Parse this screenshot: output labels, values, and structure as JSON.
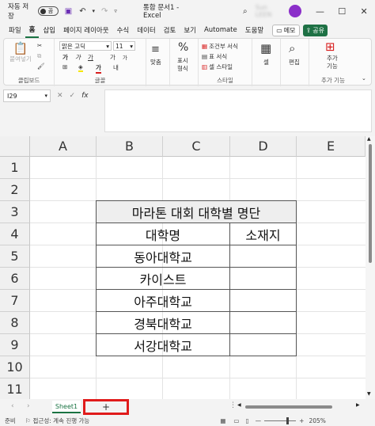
{
  "titlebar": {
    "autosave_label": "자동 저장",
    "autosave_state": "끔",
    "doc_title": "통합 문서1  -  Excel",
    "user_name": "Sun LEEN",
    "minimize": "—",
    "maximize": "☐",
    "close": "✕"
  },
  "menu": {
    "items": [
      "파일",
      "홈",
      "삽입",
      "페이지 레이아웃",
      "수식",
      "데이터",
      "검토",
      "보기",
      "Automate",
      "도움말"
    ],
    "memo": "메모",
    "share": "공유"
  },
  "ribbon": {
    "clipboard": {
      "paste": "붙여넣기",
      "label": "클립보드"
    },
    "font": {
      "name": "맑은 고딕",
      "size": "11",
      "bold": "가",
      "italic": "가",
      "underline": "가",
      "grow": "가",
      "shrink": "가",
      "label": "글꼴"
    },
    "alignment": {
      "label": "맞춤"
    },
    "number": {
      "label1": "표시",
      "label2": "형식"
    },
    "styles": {
      "conditional": "조건부 서식",
      "table": "표 서식",
      "cell_style": "셀 스타일",
      "label": "스타일"
    },
    "cells": {
      "label": "셀"
    },
    "editing": {
      "label": "편집"
    },
    "addins": {
      "btn1": "추가",
      "btn2": "기능",
      "label": "추가 기능"
    }
  },
  "formula_bar": {
    "name_box": "I29",
    "cancel": "✕",
    "enter": "✓",
    "fx": "fx",
    "value": ""
  },
  "grid": {
    "columns": [
      "A",
      "B",
      "C",
      "D",
      "E"
    ],
    "rows": [
      "1",
      "2",
      "3",
      "4",
      "5",
      "6",
      "7",
      "8",
      "9",
      "10",
      "11"
    ],
    "table_title": "마라톤 대회 대학별 명단",
    "header_university": "대학명",
    "header_location": "소재지",
    "universities": [
      "동아대학교",
      "카이스트",
      "아주대학교",
      "경북대학교",
      "서강대학교"
    ]
  },
  "sheets": {
    "tabs": [
      "Sheet1"
    ],
    "add": "+"
  },
  "status": {
    "ready": "준비",
    "accessibility": "접근성: 계속 진행 가능",
    "zoom": "205%"
  }
}
